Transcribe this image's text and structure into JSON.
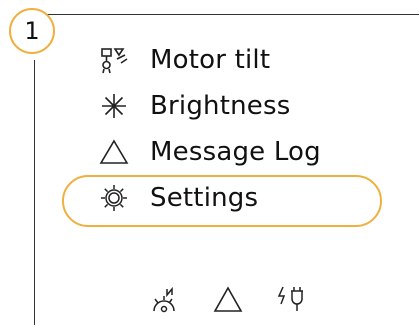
{
  "step": {
    "number": "1"
  },
  "menu": {
    "items": [
      {
        "label": "Motor tilt",
        "icon": "motor-tilt-icon"
      },
      {
        "label": "Brightness",
        "icon": "brightness-icon"
      },
      {
        "label": "Message Log",
        "icon": "warning-triangle-icon"
      },
      {
        "label": "Settings",
        "icon": "settings-gear-icon",
        "selected": true
      }
    ]
  },
  "status_bar": {
    "icons": [
      "night-mode-icon",
      "warning-triangle-icon",
      "power-plug-icon"
    ]
  },
  "colors": {
    "accent": "#f0b040",
    "line": "#333333",
    "text": "#111111"
  }
}
